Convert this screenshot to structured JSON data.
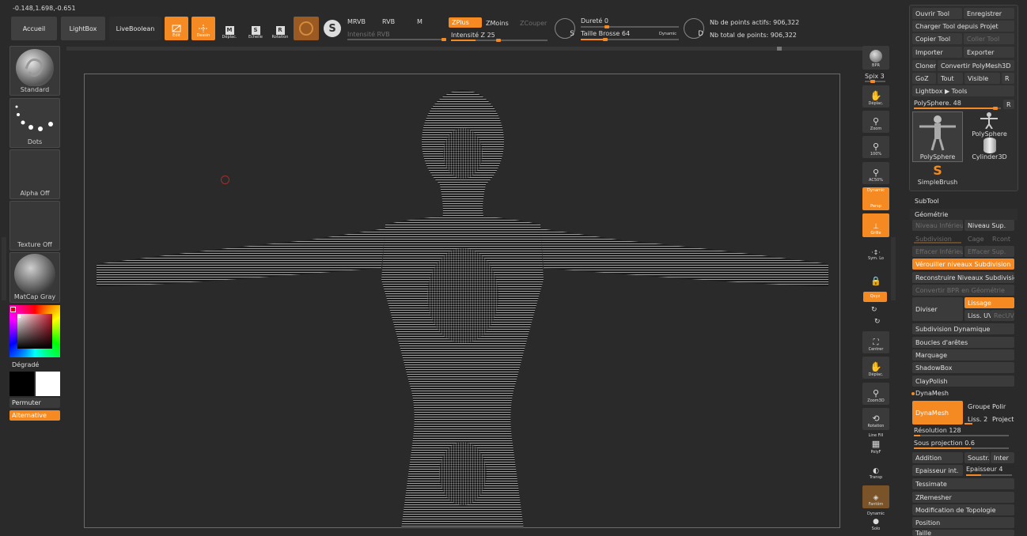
{
  "coords": "-0.148,1.698,-0.651",
  "nav": {
    "accueil": "Accueil",
    "lightbox": "LightBox",
    "liveboolean": "LiveBoolean"
  },
  "modes": {
    "edit": "Edit",
    "dessin": "Dessin",
    "deplac": "Déplac.",
    "echelle": "Echelle",
    "rotation": "Rotation"
  },
  "color_modes": {
    "mrvb": "MRVB",
    "rvb": "RVB",
    "m": "M",
    "intensite_rvb": "Intensité RVB"
  },
  "z_modes": {
    "zplus": "ZPlus",
    "zmoins": "ZMoins",
    "zcouper": "ZCouper",
    "intensite_z_label": "Intensité Z",
    "intensite_z_value": "25",
    "intensite_z_fraction": 0.25
  },
  "brush": {
    "durete_label": "Dureté",
    "durete_value": "0",
    "durete_fraction": 0.0,
    "taille_label": "Taille Brosse",
    "taille_value": "64",
    "taille_fraction": 0.4,
    "dynamic": "Dynamic",
    "s_letter": "S",
    "d_letter": "D"
  },
  "stats": {
    "actifs": "Nb de points actifs: 906,322",
    "total": "Nb total de points: 906,322"
  },
  "left": {
    "standard": "Standard",
    "dots": "Dots",
    "alpha": "Alpha Off",
    "texture": "Texture Off",
    "matcap": "MatCap Gray",
    "degrade": "Dégradé",
    "permuter": "Permuter",
    "alternative": "Alternative"
  },
  "right_shelf": {
    "bpr": "BPR",
    "spix_label": "Spix",
    "spix_value": "3",
    "deplac": "Déplac.",
    "zoom": "Zoom",
    "p100": "100%",
    "ac50": "AC50%",
    "persp_dyn": "Dynamic",
    "persp": "Persp",
    "grille": "Grille",
    "symlo": "Sym. Lo",
    "qxyz": "Qxyz",
    "centrer": "Centrer",
    "deplac2": "Déplac.",
    "zoom3d": "Zoom3D",
    "rotation": "Rotation",
    "linefill": "Line Fill",
    "polyf": "PolyF",
    "transp": "Transp",
    "fantome": "Fantôm",
    "solo_dyn": "Dynamic",
    "solo": "Solo"
  },
  "tool": {
    "ouvrir": "Ouvrir Tool",
    "enregistrer": "Enregistrer",
    "charger": "Charger Tool depuis Projet",
    "copier": "Copier Tool",
    "coller": "Coller Tool",
    "importer": "Importer",
    "exporter": "Exporter",
    "cloner": "Cloner",
    "convertir": "Convertir PolyMesh3D",
    "goz": "GoZ",
    "tout": "Tout",
    "visible": "Visible",
    "r": "R",
    "lightbox": "Lightbox ▶ Tools",
    "polysphere_label": "PolySphere.",
    "polysphere_value": "48",
    "polysphere_fraction": 0.9,
    "thumb1": "PolySphere",
    "thumb2": "PolySphere",
    "thumb3": "Cylinder3D",
    "thumb4": "SimpleBrush"
  },
  "subtool": "SubTool",
  "geometrie": {
    "title": "Géométrie",
    "niv_inf": "Niveau Inférieur",
    "niv_sup": "Niveau Sup.",
    "subdivision": "Subdivision",
    "cage": "Cage",
    "rcont": "Rcont",
    "eff_inf": "Effacer Inférieur",
    "eff_sup": "Effacer Sup.",
    "verrouiller": "Vérouiller niveaux Subdivision",
    "reconstruire": "Reconstruire Niveaux Subdivision",
    "convertir_bpr": "Convertir BPR en Géométrie",
    "diviser": "Diviser",
    "lissage": "Lissage",
    "liss_uv": "Liss. UV",
    "recuv": "RecUV",
    "subdiv_dyn": "Subdivision Dynamique",
    "boucles": "Boucles d'arêtes",
    "marquage": "Marquage",
    "shadowbox": "ShadowBox",
    "claypolish": "ClayPolish"
  },
  "dynamesh": {
    "title": "DynaMesh",
    "button": "DynaMesh",
    "groupe": "Groupe",
    "polir": "Polir",
    "liss": "Liss. 2",
    "project": "Project",
    "resolution_label": "Résolution",
    "resolution_value": "128",
    "resolution_fraction": 0.06,
    "sous_proj_label": "Sous projection",
    "sous_proj_value": "0.6",
    "sous_proj_fraction": 0.6,
    "addition": "Addition",
    "soustr": "Soustr.",
    "inter": "Inter",
    "ep_int": "Epaisseur int.",
    "epaisseur_label": "Epaisseur",
    "epaisseur_value": "4",
    "epaisseur_fraction": 0.33
  },
  "more": {
    "tessimate": "Tessimate",
    "zremesher": "ZRemesher",
    "modif_topo": "Modification de Topologie",
    "position": "Position",
    "taille": "Taille"
  }
}
